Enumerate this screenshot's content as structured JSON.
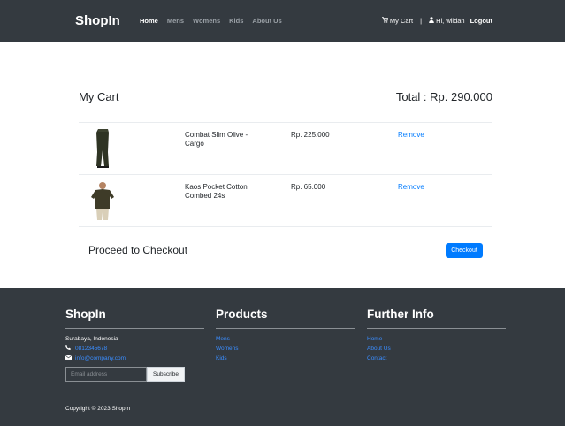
{
  "navbar": {
    "brand": "ShopIn",
    "links": [
      "Home",
      "Mens",
      "Womens",
      "Kids",
      "About Us"
    ],
    "active_link": "Home",
    "cart_label": "My Cart",
    "separator": "|",
    "greeting": "Hi, wildan",
    "logout_label": "Logout",
    "cart_icon": "shopping-cart-icon",
    "user_icon": "user-icon"
  },
  "cart": {
    "title": "My Cart",
    "total": "Total : Rp. 290.000",
    "items": [
      {
        "name": "Combat Slim Olive - Cargo",
        "price": "Rp. 225.000",
        "remove_label": "Remove",
        "image": "olive-cargo-pants-image"
      },
      {
        "name": "Kaos Pocket Cotton Combed 24s",
        "price": "Rp. 65.000",
        "remove_label": "Remove",
        "image": "olive-tshirt-image"
      }
    ],
    "proceed_label": "Proceed to Checkout",
    "checkout_label": "Checkout",
    "checkout_color": "#007bff"
  },
  "footer": {
    "brand": "ShopIn",
    "location": "Surabaya, Indonesia",
    "phone": "0812345678",
    "email": "info@company.com",
    "email_placeholder": "Email address",
    "subscribe_label": "Subscribe",
    "products_title": "Products",
    "products_links": [
      "Mens",
      "Womens",
      "Kids"
    ],
    "info_title": "Further Info",
    "info_links": [
      "Home",
      "About Us",
      "Contact"
    ],
    "copyright": "Copyright © 2023 ShopIn",
    "background": "#343a40",
    "link_color": "#3a8dff"
  }
}
